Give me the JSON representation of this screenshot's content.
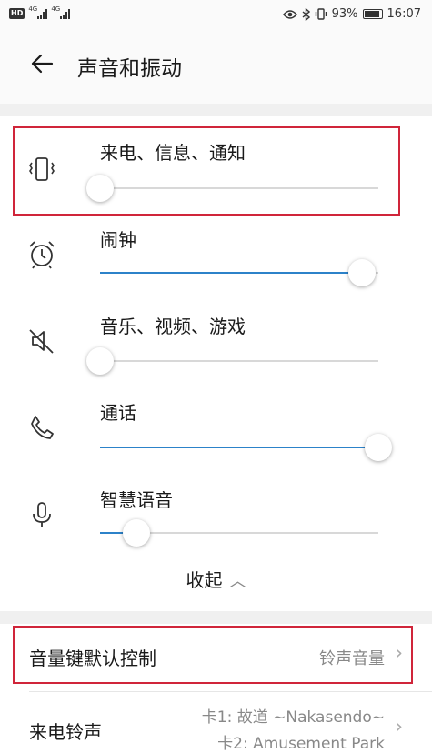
{
  "status_bar": {
    "hd_badge": "HD",
    "sig1_tag": "4G",
    "sig2_tag": "4G",
    "battery_percent": "93%",
    "time": "16:07"
  },
  "header": {
    "title": "声音和振动"
  },
  "volume_rows": [
    {
      "label": "来电、信息、通知",
      "icon": "vibrate-icon",
      "level": 0.0
    },
    {
      "label": "闹钟",
      "icon": "alarm-clock-icon",
      "level": 0.94
    },
    {
      "label": "音乐、视频、游戏",
      "icon": "mute-speaker-icon",
      "level": 0.0
    },
    {
      "label": "通话",
      "icon": "phone-icon",
      "level": 1.0
    },
    {
      "label": "智慧语音",
      "icon": "microphone-icon",
      "level": 0.13
    }
  ],
  "collapse": {
    "label": "收起",
    "icon": "chevron-up-icon"
  },
  "settings": {
    "volume_key": {
      "label": "音量键默认控制",
      "value": "铃声音量"
    },
    "ringtone": {
      "label": "来电铃声",
      "value_line1": "卡1: 故道 ~Nakasendo~",
      "value_line2": "卡2: Amusement Park"
    }
  },
  "colors": {
    "accent": "#2c82c9",
    "highlight": "#d0253a"
  }
}
